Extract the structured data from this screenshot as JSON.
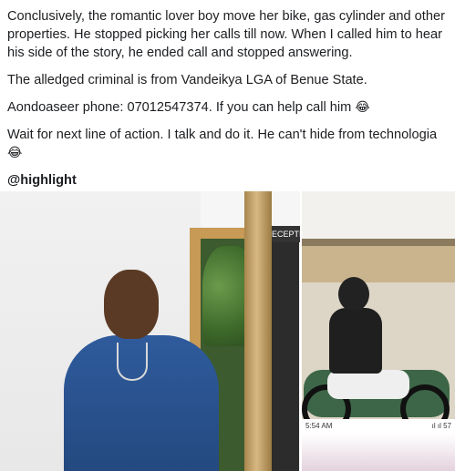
{
  "post": {
    "paragraphs": [
      "Conclusively, the romantic lover boy move her bike, gas cylinder and other properties. He stopped picking her calls till now. When I called him to hear his side of the story, he ended call and stopped answering.",
      "The alledged criminal is from Vandeikya LGA of Benue State.",
      "Aondoaseer phone: 07012547374. If you can help call him",
      "Wait for next line of action. I talk and do it. He can't hide from technologia"
    ],
    "emoji": "😂",
    "mention": "@highlight"
  },
  "photo_left": {
    "sign_text": "ECEPTIO"
  },
  "photo_right": {
    "status_time": "5:54 AM",
    "status_icons": "ıl ıl 57"
  }
}
